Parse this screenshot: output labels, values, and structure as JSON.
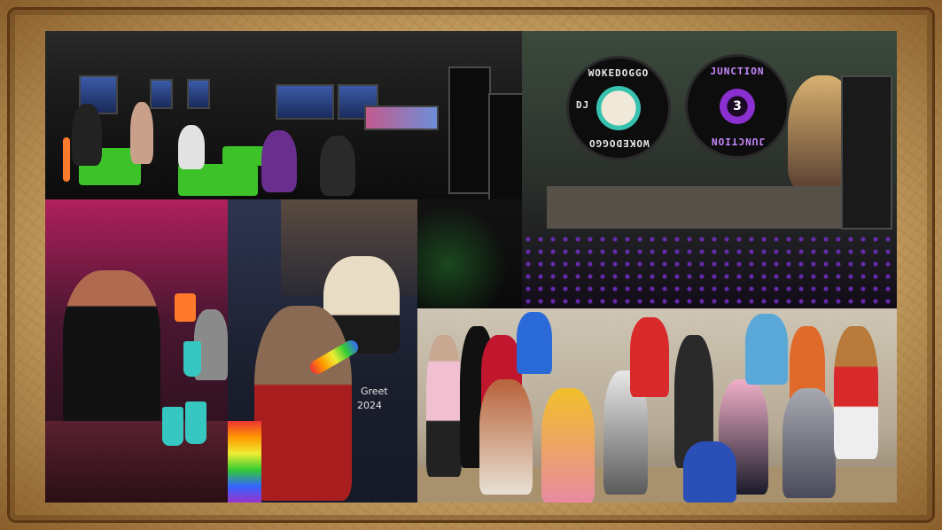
{
  "collage": {
    "panels": [
      {
        "id": "vr-lounge",
        "label": "vr lounge with screens and green sofas"
      },
      {
        "id": "dj-booth",
        "label": "dj booth with record discs"
      },
      {
        "id": "vr-bar",
        "label": "vr avatar at bar"
      },
      {
        "id": "meet-greet-selfie",
        "label": "fursuit selfie with avatar"
      },
      {
        "id": "group-photo",
        "label": "fursuiter group photo"
      }
    ]
  },
  "dj_booth": {
    "disc_left_top": "WOKEDOGGO",
    "disc_left_bottom": "WOKEDOGGO",
    "disc_left_side": "DJ",
    "disc_right_top": "JUNCTION",
    "disc_right_bottom": "JUNCTION",
    "disc_right_center": "3"
  },
  "selfie": {
    "shirt_line1": "Greet",
    "shirt_line2": "2024"
  },
  "colors": {
    "frame_parchment": "#c9a466",
    "frame_edge": "#5b3714",
    "sofa_green": "#3ec22a",
    "disc_accent": "#8a2fd0",
    "glass_teal": "#35c7c0"
  }
}
